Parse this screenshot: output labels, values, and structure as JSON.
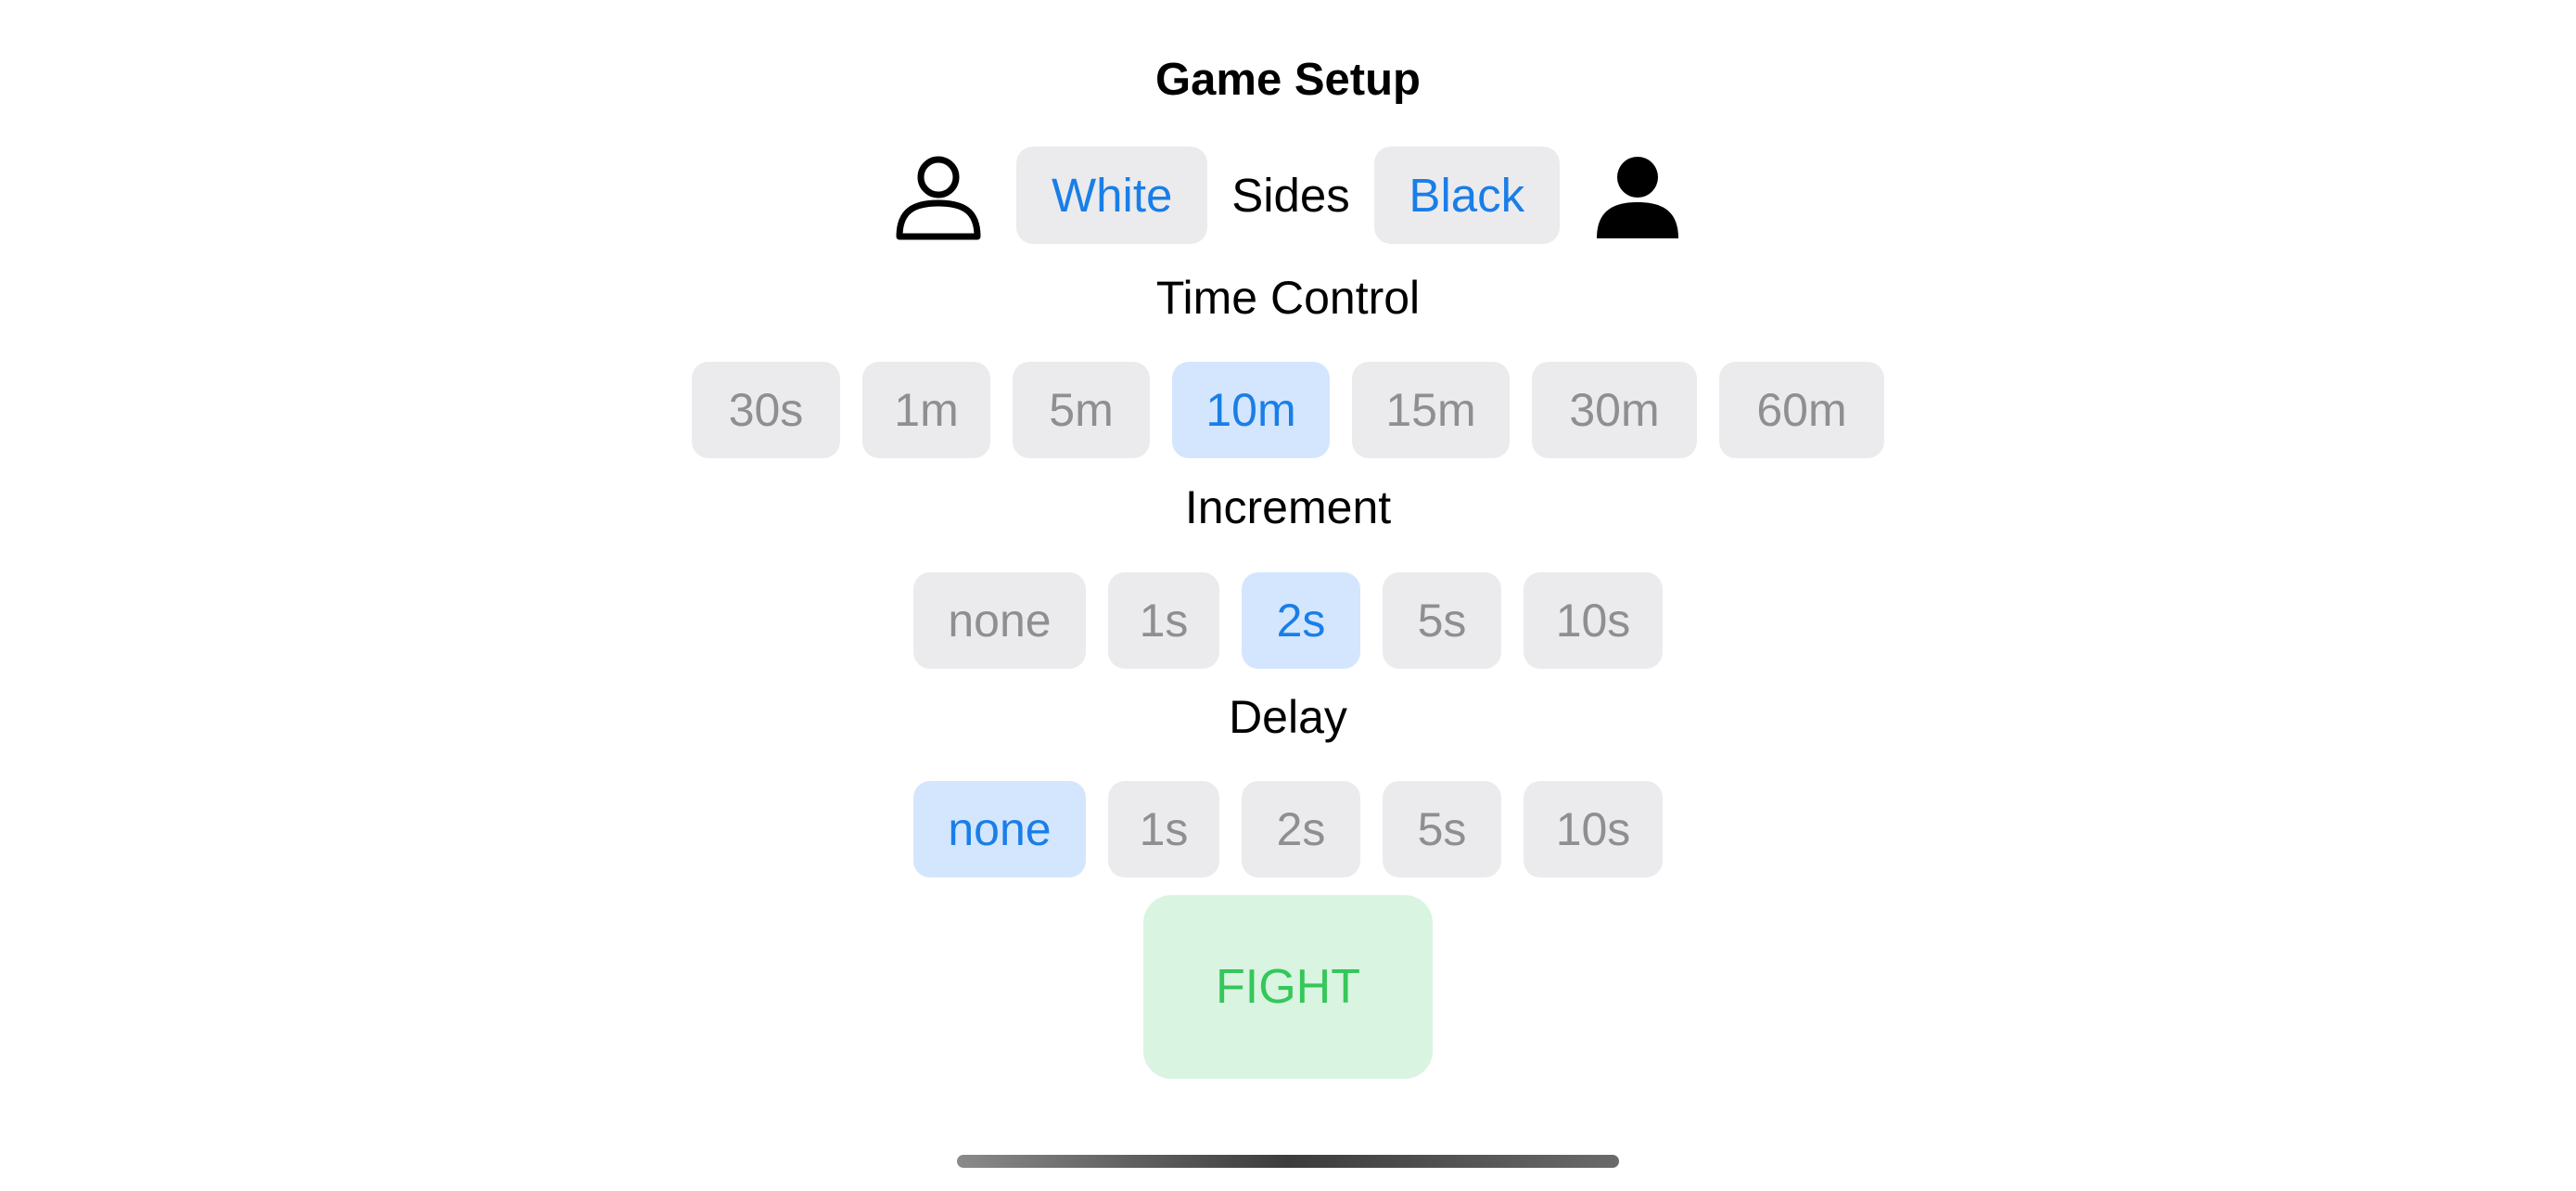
{
  "header": {
    "title": "Game Setup"
  },
  "sides": {
    "label": "Sides",
    "white_label": "White",
    "black_label": "Black",
    "left_icon": "person-outline-icon",
    "right_icon": "person-filled-icon"
  },
  "time_control": {
    "label": "Time Control",
    "selected": "10m",
    "options": [
      {
        "label": "30s",
        "selected": false
      },
      {
        "label": "1m",
        "selected": false
      },
      {
        "label": "5m",
        "selected": false
      },
      {
        "label": "10m",
        "selected": true
      },
      {
        "label": "15m",
        "selected": false
      },
      {
        "label": "30m",
        "selected": false
      },
      {
        "label": "60m",
        "selected": false
      }
    ]
  },
  "increment": {
    "label": "Increment",
    "selected": "2s",
    "options": [
      {
        "label": "none",
        "selected": false
      },
      {
        "label": "1s",
        "selected": false
      },
      {
        "label": "2s",
        "selected": true
      },
      {
        "label": "5s",
        "selected": false
      },
      {
        "label": "10s",
        "selected": false
      }
    ]
  },
  "delay": {
    "label": "Delay",
    "selected": "none",
    "options": [
      {
        "label": "none",
        "selected": true
      },
      {
        "label": "1s",
        "selected": false
      },
      {
        "label": "2s",
        "selected": false
      },
      {
        "label": "5s",
        "selected": false
      },
      {
        "label": "10s",
        "selected": false
      }
    ]
  },
  "actions": {
    "fight_label": "FIGHT"
  },
  "colors": {
    "accent_blue": "#1a7ee8",
    "selected_bg": "#d3e6fd",
    "unselected_bg": "#ebebed",
    "unselected_text": "#8e8e93",
    "fight_bg": "#d9f4e1",
    "fight_text": "#34c75a"
  }
}
